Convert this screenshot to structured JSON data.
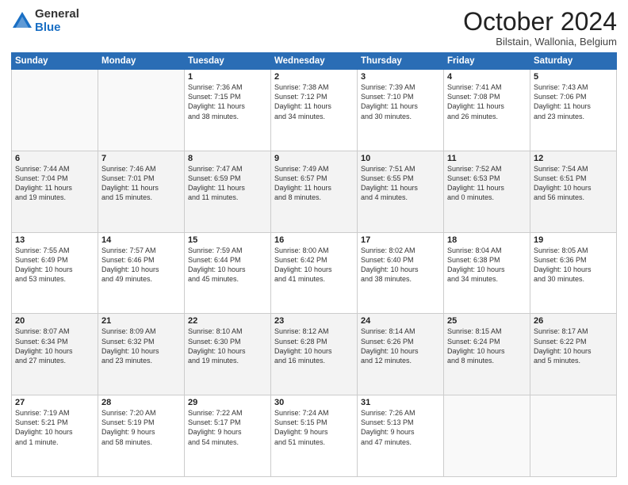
{
  "header": {
    "logo_general": "General",
    "logo_blue": "Blue",
    "month_title": "October 2024",
    "subtitle": "Bilstain, Wallonia, Belgium"
  },
  "days_of_week": [
    "Sunday",
    "Monday",
    "Tuesday",
    "Wednesday",
    "Thursday",
    "Friday",
    "Saturday"
  ],
  "weeks": [
    [
      {
        "day": "",
        "detail": ""
      },
      {
        "day": "",
        "detail": ""
      },
      {
        "day": "1",
        "detail": "Sunrise: 7:36 AM\nSunset: 7:15 PM\nDaylight: 11 hours\nand 38 minutes."
      },
      {
        "day": "2",
        "detail": "Sunrise: 7:38 AM\nSunset: 7:12 PM\nDaylight: 11 hours\nand 34 minutes."
      },
      {
        "day": "3",
        "detail": "Sunrise: 7:39 AM\nSunset: 7:10 PM\nDaylight: 11 hours\nand 30 minutes."
      },
      {
        "day": "4",
        "detail": "Sunrise: 7:41 AM\nSunset: 7:08 PM\nDaylight: 11 hours\nand 26 minutes."
      },
      {
        "day": "5",
        "detail": "Sunrise: 7:43 AM\nSunset: 7:06 PM\nDaylight: 11 hours\nand 23 minutes."
      }
    ],
    [
      {
        "day": "6",
        "detail": "Sunrise: 7:44 AM\nSunset: 7:04 PM\nDaylight: 11 hours\nand 19 minutes."
      },
      {
        "day": "7",
        "detail": "Sunrise: 7:46 AM\nSunset: 7:01 PM\nDaylight: 11 hours\nand 15 minutes."
      },
      {
        "day": "8",
        "detail": "Sunrise: 7:47 AM\nSunset: 6:59 PM\nDaylight: 11 hours\nand 11 minutes."
      },
      {
        "day": "9",
        "detail": "Sunrise: 7:49 AM\nSunset: 6:57 PM\nDaylight: 11 hours\nand 8 minutes."
      },
      {
        "day": "10",
        "detail": "Sunrise: 7:51 AM\nSunset: 6:55 PM\nDaylight: 11 hours\nand 4 minutes."
      },
      {
        "day": "11",
        "detail": "Sunrise: 7:52 AM\nSunset: 6:53 PM\nDaylight: 11 hours\nand 0 minutes."
      },
      {
        "day": "12",
        "detail": "Sunrise: 7:54 AM\nSunset: 6:51 PM\nDaylight: 10 hours\nand 56 minutes."
      }
    ],
    [
      {
        "day": "13",
        "detail": "Sunrise: 7:55 AM\nSunset: 6:49 PM\nDaylight: 10 hours\nand 53 minutes."
      },
      {
        "day": "14",
        "detail": "Sunrise: 7:57 AM\nSunset: 6:46 PM\nDaylight: 10 hours\nand 49 minutes."
      },
      {
        "day": "15",
        "detail": "Sunrise: 7:59 AM\nSunset: 6:44 PM\nDaylight: 10 hours\nand 45 minutes."
      },
      {
        "day": "16",
        "detail": "Sunrise: 8:00 AM\nSunset: 6:42 PM\nDaylight: 10 hours\nand 41 minutes."
      },
      {
        "day": "17",
        "detail": "Sunrise: 8:02 AM\nSunset: 6:40 PM\nDaylight: 10 hours\nand 38 minutes."
      },
      {
        "day": "18",
        "detail": "Sunrise: 8:04 AM\nSunset: 6:38 PM\nDaylight: 10 hours\nand 34 minutes."
      },
      {
        "day": "19",
        "detail": "Sunrise: 8:05 AM\nSunset: 6:36 PM\nDaylight: 10 hours\nand 30 minutes."
      }
    ],
    [
      {
        "day": "20",
        "detail": "Sunrise: 8:07 AM\nSunset: 6:34 PM\nDaylight: 10 hours\nand 27 minutes."
      },
      {
        "day": "21",
        "detail": "Sunrise: 8:09 AM\nSunset: 6:32 PM\nDaylight: 10 hours\nand 23 minutes."
      },
      {
        "day": "22",
        "detail": "Sunrise: 8:10 AM\nSunset: 6:30 PM\nDaylight: 10 hours\nand 19 minutes."
      },
      {
        "day": "23",
        "detail": "Sunrise: 8:12 AM\nSunset: 6:28 PM\nDaylight: 10 hours\nand 16 minutes."
      },
      {
        "day": "24",
        "detail": "Sunrise: 8:14 AM\nSunset: 6:26 PM\nDaylight: 10 hours\nand 12 minutes."
      },
      {
        "day": "25",
        "detail": "Sunrise: 8:15 AM\nSunset: 6:24 PM\nDaylight: 10 hours\nand 8 minutes."
      },
      {
        "day": "26",
        "detail": "Sunrise: 8:17 AM\nSunset: 6:22 PM\nDaylight: 10 hours\nand 5 minutes."
      }
    ],
    [
      {
        "day": "27",
        "detail": "Sunrise: 7:19 AM\nSunset: 5:21 PM\nDaylight: 10 hours\nand 1 minute."
      },
      {
        "day": "28",
        "detail": "Sunrise: 7:20 AM\nSunset: 5:19 PM\nDaylight: 9 hours\nand 58 minutes."
      },
      {
        "day": "29",
        "detail": "Sunrise: 7:22 AM\nSunset: 5:17 PM\nDaylight: 9 hours\nand 54 minutes."
      },
      {
        "day": "30",
        "detail": "Sunrise: 7:24 AM\nSunset: 5:15 PM\nDaylight: 9 hours\nand 51 minutes."
      },
      {
        "day": "31",
        "detail": "Sunrise: 7:26 AM\nSunset: 5:13 PM\nDaylight: 9 hours\nand 47 minutes."
      },
      {
        "day": "",
        "detail": ""
      },
      {
        "day": "",
        "detail": ""
      }
    ]
  ]
}
